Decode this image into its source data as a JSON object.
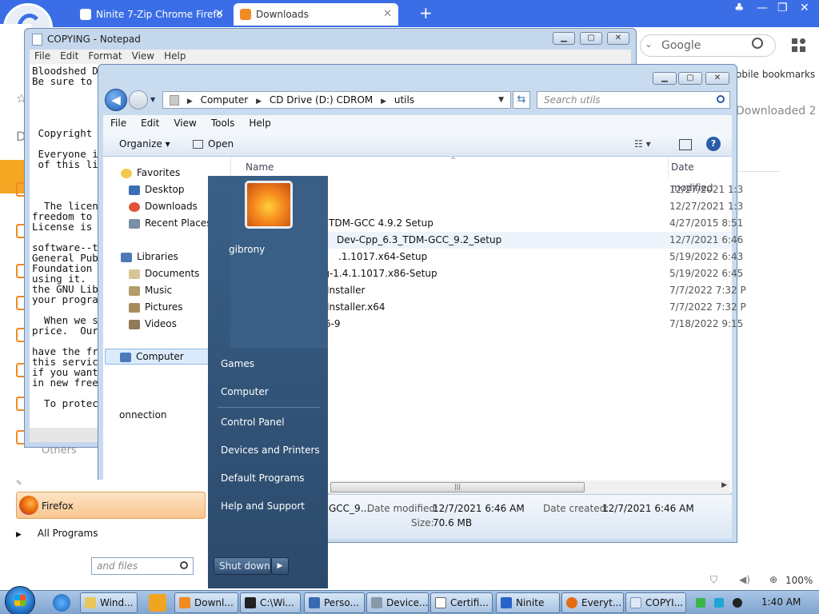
{
  "browser": {
    "tabs": [
      {
        "label": "Ninite 7-Zip Chrome Firefo",
        "active": false
      },
      {
        "label": "Downloads",
        "active": true
      }
    ],
    "search_placeholder": "Google",
    "bookmarks_text": "obile bookmarks",
    "downloaded_text": "Downloaded 2",
    "left_letter": "D",
    "others_label": "Others",
    "zoom": "100%"
  },
  "notepad": {
    "title": "COPYING - Notepad",
    "menu": [
      "File",
      "Edit",
      "Format",
      "View",
      "Help"
    ],
    "text": "Bloodshed D\nBe sure to\n\n\n\n\n Copyright\n\n Everyone i\n of this li\n\n\n\n  The licen\nfreedom to\nLicense is\n\nsoftware--t\nGeneral Pub\nFoundation\nusing it.\nthe GNU Lib\nyour progra\n\n  When we s\nprice.  Our\n\nhave the fr\nthis servic\nif you want\nin new free\n\n  To protec"
  },
  "explorer": {
    "breadcrumb": [
      "Computer",
      "CD Drive (D:) CDROM",
      "utils"
    ],
    "search_placeholder": "Search utils",
    "menu": [
      "File",
      "Edit",
      "View",
      "Tools",
      "Help"
    ],
    "toolbar": {
      "organize": "Organize",
      "open": "Open"
    },
    "nav": {
      "favorites": "Favorites",
      "desktop": "Desktop",
      "downloads": "Downloads",
      "recent": "Recent Places",
      "libraries": "Libraries",
      "documents": "Documents",
      "music": "Music",
      "pictures": "Pictures",
      "videos": "Videos",
      "computer": "Computer",
      "connection": "onnection"
    },
    "columns": {
      "name": "Name",
      "date": "Date modified"
    },
    "rows": [
      {
        "name": "",
        "date": "12/27/2021 1:3"
      },
      {
        "name": "",
        "date": "12/27/2021 1:3"
      },
      {
        "name": "TDM-GCC 4.9.2 Setup",
        "date": "4/27/2015 8:51"
      },
      {
        "name": "Dev-Cpp_6.3_TDM-GCC_9.2_Setup",
        "date": "12/7/2021 6:46"
      },
      {
        "name": ".1.1017.x64-Setup",
        "date": "5/19/2022 6:43"
      },
      {
        "name": "Everything-1.4.1.1017.x86-Setup",
        "date": "5/19/2022 6:45"
      },
      {
        "name": "npp.8.4.3.Installer",
        "date": "7/7/2022 7:32 P"
      },
      {
        "name": "npp.8.4.3.Installer.x64",
        "date": "7/7/2022 7:32 P"
      },
      {
        "name": "redlockT86-9",
        "date": "7/18/2022 9:15"
      }
    ],
    "details": {
      "name": "GCC_9....",
      "date_modified_label": "Date modified:",
      "date_modified": "12/7/2021 6:46 AM",
      "date_created_label": "Date created:",
      "date_created": "12/7/2021 6:46 AM",
      "size_label": "Size:",
      "size": "70.6 MB"
    }
  },
  "start_menu": {
    "user": "gibrony",
    "right_links": [
      "Games",
      "Computer",
      "Control Panel",
      "Devices and Printers",
      "Default Programs",
      "Help and Support"
    ],
    "pinned": "Firefox",
    "all_programs": "All Programs",
    "search_placeholder": "and files",
    "shutdown": "Shut down"
  },
  "taskbar": {
    "buttons": [
      "Wind...",
      "Downl...",
      "C:\\Wi...",
      "Perso...",
      "Device...",
      "Certifi...",
      "Ninite",
      "Everyt...",
      "COPYI..."
    ],
    "clock": "1:40 AM"
  }
}
